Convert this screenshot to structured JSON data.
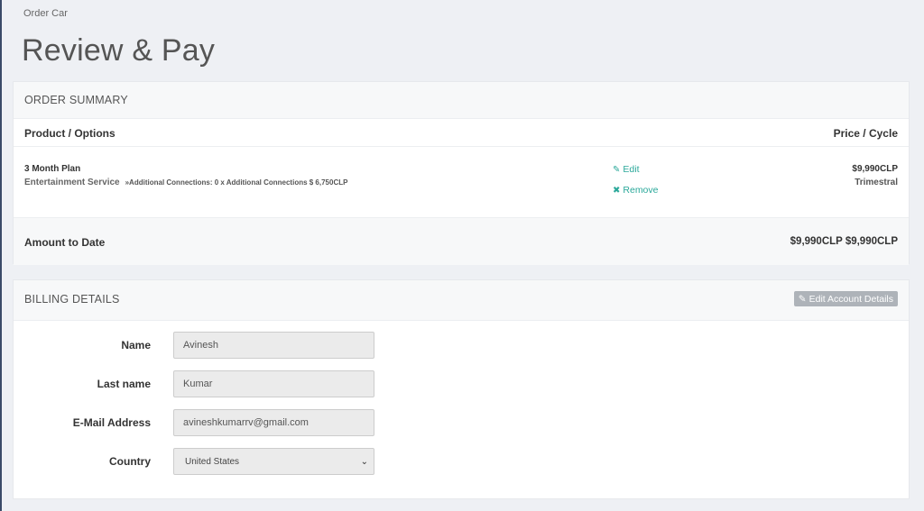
{
  "breadcrumb": "Order Car",
  "page_title": "Review & Pay",
  "order_summary": {
    "title": "ORDER SUMMARY",
    "col_product": "Product / Options",
    "col_price": "Price / Cycle",
    "item": {
      "plan": "3 Month Plan",
      "service": "Entertainment Service",
      "additional": "»Additional Connections: 0 x Additional Connections $ 6,750CLP",
      "edit_label": "Edit",
      "remove_label": "Remove",
      "price": "$9,990CLP",
      "cycle": "Trimestral"
    },
    "amount_label": "Amount to Date",
    "amount_value": "$9,990CLP $9,990CLP"
  },
  "billing": {
    "title": "BILLING DETAILS",
    "edit_button": "Edit Account Details",
    "fields": {
      "name": {
        "label": "Name",
        "value": "Avinesh"
      },
      "last_name": {
        "label": "Last name",
        "value": "Kumar"
      },
      "email": {
        "label": "E-Mail Address",
        "value": "avineshkumarrv@gmail.com"
      },
      "country": {
        "label": "Country",
        "value": "United States"
      }
    }
  },
  "colors": {
    "accent": "#2aa89a",
    "button_gray": "#aeb3b9",
    "nav_edge": "#3b4a68"
  },
  "icons": {
    "edit": "pencil-icon",
    "remove": "close-icon",
    "edit_account": "edit-square-icon",
    "select": "chevron-down-icon"
  }
}
